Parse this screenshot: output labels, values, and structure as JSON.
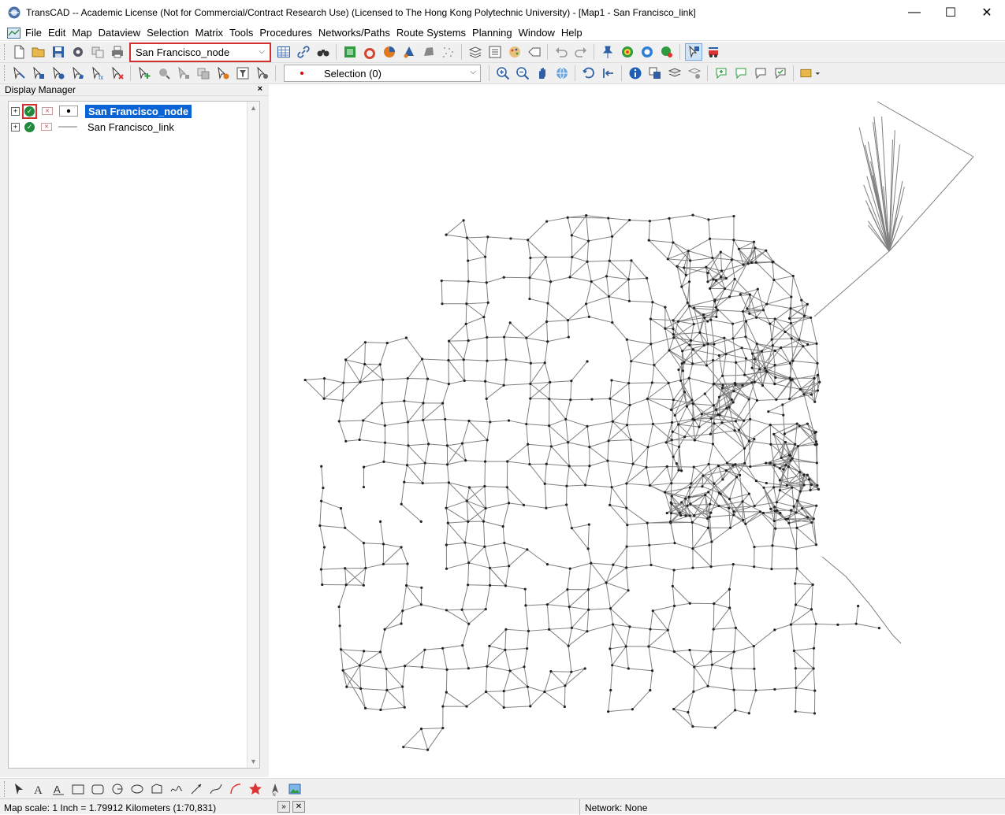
{
  "window": {
    "title": "TransCAD -- Academic License (Not for Commercial/Contract Research Use) (Licensed to The Hong Kong Polytechnic University) - [Map1 - San Francisco_link]",
    "minimize": "—",
    "maximize": "☐",
    "close": "✕"
  },
  "menu": [
    {
      "label": "File"
    },
    {
      "label": "Edit"
    },
    {
      "label": "Map"
    },
    {
      "label": "Dataview"
    },
    {
      "label": "Selection"
    },
    {
      "label": "Matrix"
    },
    {
      "label": "Tools"
    },
    {
      "label": "Procedures"
    },
    {
      "label": "Networks/Paths"
    },
    {
      "label": "Route Systems"
    },
    {
      "label": "Planning"
    },
    {
      "label": "Window"
    },
    {
      "label": "Help"
    }
  ],
  "toolbar": {
    "layer_select": "San Francisco_node",
    "selection_set": "Selection (0)"
  },
  "display_manager": {
    "title": "Display Manager",
    "close": "×",
    "layers": [
      {
        "name": "San Francisco_node",
        "selected": true,
        "style": "point"
      },
      {
        "name": "San Francisco_link",
        "selected": false,
        "style": "line"
      }
    ]
  },
  "status": {
    "scale": "Map scale: 1 Inch = 1.79912 Kilometers (1:70,831)",
    "network": "Network: None"
  },
  "colors": {
    "accent": "#0a64d6",
    "highlight_border": "#d32f2f",
    "visible_check": "#1f8a3b",
    "link_color": "#808080",
    "node_color": "#222222"
  }
}
